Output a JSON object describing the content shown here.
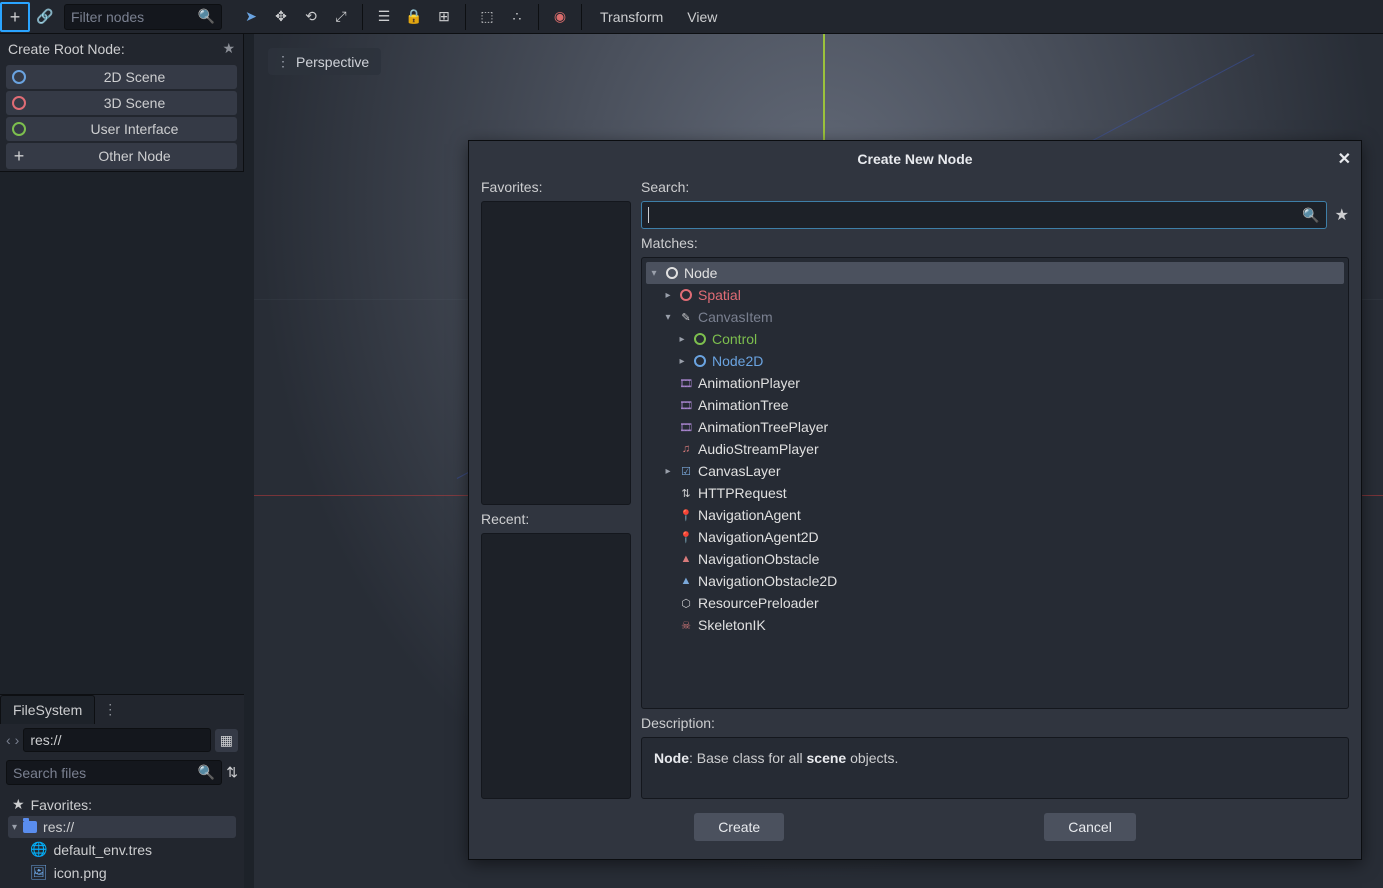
{
  "toolbar": {
    "filter_placeholder": "Filter nodes",
    "menus": [
      "Transform",
      "View"
    ]
  },
  "scene_dock": {
    "create_root_label": "Create Root Node:",
    "buttons": {
      "scene2d": "2D Scene",
      "scene3d": "3D Scene",
      "ui": "User Interface",
      "other": "Other Node"
    }
  },
  "viewport": {
    "perspective_label": "Perspective"
  },
  "filesystem": {
    "tab": "FileSystem",
    "path": "res://",
    "search_placeholder": "Search files",
    "favorites_label": "Favorites:",
    "tree": {
      "root": "res://",
      "files": [
        "default_env.tres",
        "icon.png"
      ]
    }
  },
  "dialog": {
    "title": "Create New Node",
    "favorites_label": "Favorites:",
    "recent_label": "Recent:",
    "search_label": "Search:",
    "matches_label": "Matches:",
    "description_label": "Description:",
    "description_html": "Node: Base class for all scene objects.",
    "desc_bold1": "Node",
    "desc_text1": ": Base class for all ",
    "desc_bold2": "scene",
    "desc_text2": " objects.",
    "create_btn": "Create",
    "cancel_btn": "Cancel",
    "tree": [
      {
        "name": "Node",
        "indent": 0,
        "exp": "down",
        "iconType": "ring",
        "colorClass": "col-white",
        "ringClass": "",
        "selected": true
      },
      {
        "name": "Spatial",
        "indent": 1,
        "exp": "right",
        "iconType": "ring",
        "colorClass": "col-red",
        "ringClass": "red"
      },
      {
        "name": "CanvasItem",
        "indent": 1,
        "exp": "down",
        "iconType": "glyph",
        "glyph": "✎",
        "colorClass": "col-muted"
      },
      {
        "name": "Control",
        "indent": 2,
        "exp": "right",
        "iconType": "ring",
        "colorClass": "col-green",
        "ringClass": "green"
      },
      {
        "name": "Node2D",
        "indent": 2,
        "exp": "right",
        "iconType": "ring",
        "colorClass": "col-blue",
        "ringClass": "blue"
      },
      {
        "name": "AnimationPlayer",
        "indent": 1,
        "exp": "",
        "iconType": "glyph",
        "glyph": "🎞",
        "colorClass": "col-white",
        "iconColor": "#b28bd9"
      },
      {
        "name": "AnimationTree",
        "indent": 1,
        "exp": "",
        "iconType": "glyph",
        "glyph": "🎞",
        "colorClass": "col-white",
        "iconColor": "#b28bd9"
      },
      {
        "name": "AnimationTreePlayer",
        "indent": 1,
        "exp": "",
        "iconType": "glyph",
        "glyph": "🎞",
        "colorClass": "col-white",
        "iconColor": "#b28bd9"
      },
      {
        "name": "AudioStreamPlayer",
        "indent": 1,
        "exp": "",
        "iconType": "glyph",
        "glyph": "♫",
        "colorClass": "col-white",
        "iconColor": "#d97b7b"
      },
      {
        "name": "CanvasLayer",
        "indent": 1,
        "exp": "right",
        "iconType": "glyph",
        "glyph": "☑",
        "colorClass": "col-white",
        "iconColor": "#7aa8d9"
      },
      {
        "name": "HTTPRequest",
        "indent": 1,
        "exp": "",
        "iconType": "glyph",
        "glyph": "⇅",
        "colorClass": "col-white"
      },
      {
        "name": "NavigationAgent",
        "indent": 1,
        "exp": "",
        "iconType": "glyph",
        "glyph": "📍",
        "colorClass": "col-white",
        "iconColor": "#d97b7b"
      },
      {
        "name": "NavigationAgent2D",
        "indent": 1,
        "exp": "",
        "iconType": "glyph",
        "glyph": "📍",
        "colorClass": "col-white",
        "iconColor": "#7aa8d9"
      },
      {
        "name": "NavigationObstacle",
        "indent": 1,
        "exp": "",
        "iconType": "glyph",
        "glyph": "▲",
        "colorClass": "col-white",
        "iconColor": "#d97b7b"
      },
      {
        "name": "NavigationObstacle2D",
        "indent": 1,
        "exp": "",
        "iconType": "glyph",
        "glyph": "▲",
        "colorClass": "col-white",
        "iconColor": "#7aa8d9"
      },
      {
        "name": "ResourcePreloader",
        "indent": 1,
        "exp": "",
        "iconType": "glyph",
        "glyph": "⬡",
        "colorClass": "col-white"
      },
      {
        "name": "SkeletonIK",
        "indent": 1,
        "exp": "",
        "iconType": "glyph",
        "glyph": "☠",
        "colorClass": "col-white",
        "iconColor": "#d97b7b"
      }
    ]
  }
}
